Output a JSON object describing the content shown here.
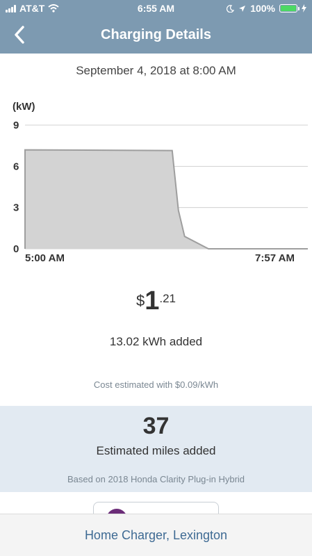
{
  "status_bar": {
    "carrier": "AT&T",
    "time": "6:55 AM",
    "battery": "100%",
    "icons": [
      "signal-icon",
      "wifi-icon",
      "moon-icon",
      "location-arrow-icon",
      "battery-icon",
      "charging-bolt-icon"
    ]
  },
  "nav": {
    "title": "Charging Details",
    "back_icon": "chevron-left-icon"
  },
  "session": {
    "date": "September 4, 2018 at 8:00 AM"
  },
  "chart_data": {
    "type": "area",
    "ylabel": "(kW)",
    "ylim": [
      0,
      9
    ],
    "yticks": [
      "0",
      "3",
      "6",
      "9"
    ],
    "x_labels": [
      "5:00 AM",
      "7:57 AM"
    ],
    "grid": true,
    "series": [
      {
        "x": [
          "5:00 AM",
          "7:22 AM",
          "7:28 AM",
          "7:34 AM",
          "7:57 AM"
        ],
        "values": [
          7.2,
          7.15,
          2.8,
          0.9,
          0
        ]
      }
    ],
    "fill_color": "#d3d3d3",
    "line_color": "#9e9e9e"
  },
  "cost": {
    "symbol": "$",
    "whole": "1",
    "cents": ".21"
  },
  "energy": {
    "added": "13.02 kWh added",
    "rate_note": "Cost estimated with $0.09/kWh"
  },
  "miles": {
    "value": "37",
    "label": "Estimated miles added",
    "basis": "Based on 2018 Honda Clarity Plug-in Hybrid"
  },
  "bottom": {
    "charger_name": "Home Charger, Lexington"
  },
  "colors": {
    "header": "#7d9ab1",
    "panel": "#e2eaf2",
    "link": "#3e6a93"
  }
}
